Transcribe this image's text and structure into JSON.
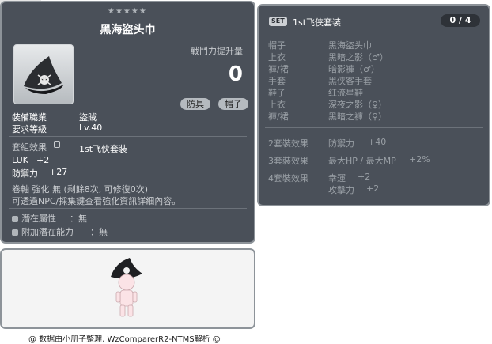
{
  "item_code": "01002185",
  "item": {
    "stars": "★★★★★",
    "name": "黑海盜头巾",
    "power_label": "戰鬥力提升量",
    "power_value": "0",
    "tag_armor": "防具",
    "tag_hat": "帽子",
    "job_label": "裝備職業",
    "job_value": "盜賊",
    "level_label": "要求等級",
    "level_value": "Lv.40",
    "set_effect_label": "套組效果",
    "set_effect_value": "1st飞侠套装",
    "luk_label": "LUK",
    "luk_value": "+2",
    "def_label": "防禦力",
    "def_value": "+27",
    "scroll_line": "卷軸 強化 無 (剩餘8次, 可修復0次)",
    "npc_line": "可透過NPC/採集鍵查看強化資訊詳細內容。",
    "potential_label": "潛在屬性",
    "potential_value": "：無",
    "bonus_label": "附加潛在能力",
    "bonus_value": "：無"
  },
  "set": {
    "badge": "SET",
    "name": "1st飞侠套装",
    "count": "0 / 4",
    "pieces": [
      {
        "slot": "帽子",
        "name": "黑海盜头巾"
      },
      {
        "slot": "上衣",
        "name": "黑暗之影（♂）"
      },
      {
        "slot": "褲/裙",
        "name": "暗影褲（♂）"
      },
      {
        "slot": "手套",
        "name": "黑侠客手套"
      },
      {
        "slot": "鞋子",
        "name": "红流星鞋"
      },
      {
        "slot": "上衣",
        "name": "深夜之影（♀）"
      },
      {
        "slot": "褲/裙",
        "name": "黑暗之褲（♀）"
      }
    ],
    "bonus2_label": "2套裝效果",
    "bonus2_stat": "防禦力",
    "bonus2_value": "+40",
    "bonus3_label": "3套裝效果",
    "bonus3_stat": "最大HP / 最大MP",
    "bonus3_value": "+2%",
    "bonus4_label": "4套裝效果",
    "bonus4_stat1": "幸運",
    "bonus4_value1": "+2",
    "bonus4_stat2": "攻擊力",
    "bonus4_value2": "+2"
  },
  "footer": "@ 数据由小册子整理, WzComparerR2-NTMS解析 @"
}
